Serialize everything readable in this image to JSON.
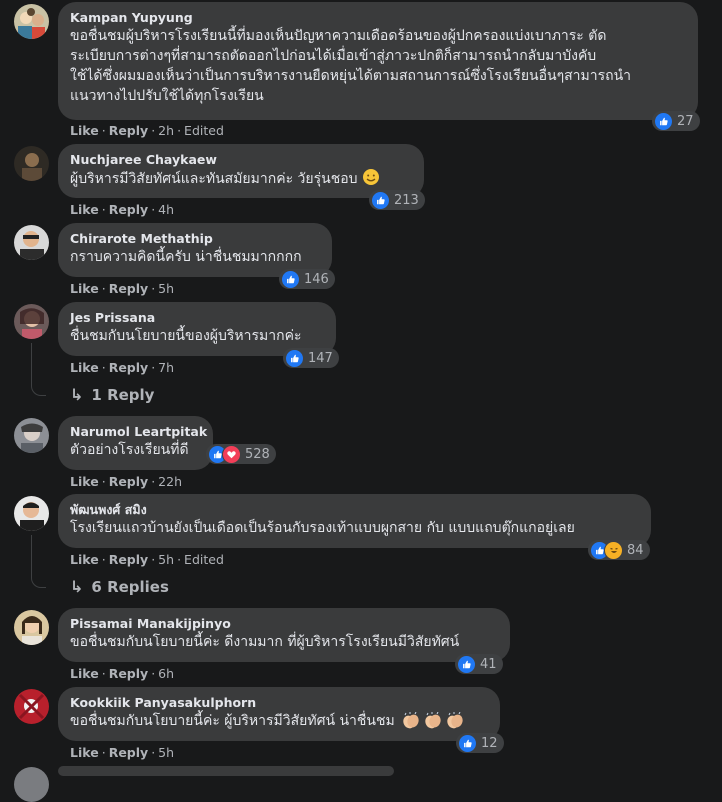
{
  "comments": [
    {
      "name": "Kampan Yupyung",
      "lines": [
        "ขอชื่นชมผู้บริหารโรงเรียนนี้ที่มองเห็นปัญหาความเดือดร้อนของผู้ปกครองแบ่งเบาภาระ ตัด",
        "ระเบียบการต่างๆที่สามารถตัดออกไปก่อนได้เมื่อเข้าสู่ภาวะปกติก็สามารถนำกลับมาบังคับ",
        "ใช้ได้ซึ่งผมมองเห็นว่าเป็นการบริหารงานยืดหยุ่นได้ตามสถานการณ์ซึ่งโรงเรียนอื่นๆสามารถนำ",
        "แนวทางไปปรับใช้ได้ทุกโรงเรียน"
      ],
      "like": "Like",
      "reply": "Reply",
      "time": "2h",
      "edited": "Edited",
      "reaction_count": "27"
    },
    {
      "name": "Nuchjaree Chaykaew",
      "text": "ผู้บริหารมีวิสัยทัศน์และทันสมัยมากค่ะ วัยรุ่นชอบ",
      "like": "Like",
      "reply": "Reply",
      "time": "4h",
      "reaction_count": "213"
    },
    {
      "name": "Chirarote Methathip",
      "text": "กราบความคิดนี้ครับ น่าชื่นชมมากกกก",
      "like": "Like",
      "reply": "Reply",
      "time": "5h",
      "reaction_count": "146"
    },
    {
      "name": "Jes Prissana",
      "text": "ชื่นชมกับนโยบายนี้ของผู้บริหารมากค่ะ",
      "like": "Like",
      "reply": "Reply",
      "time": "7h",
      "reaction_count": "147",
      "replies": "1 Reply"
    },
    {
      "name": "Narumol Leartpitak",
      "text": "ตัวอย่างโรงเรียนที่ดี",
      "like": "Like",
      "reply": "Reply",
      "time": "22h",
      "reaction_count": "528"
    },
    {
      "name": "พัฒนพงศ์ สมิง",
      "text": "โรงเรียนแถวบ้านยังเป็นเดือดเป็นร้อนกับรองเท้าแบบผูกสาย กับ แบบแถบตุ๊กแกอยู่เลย",
      "like": "Like",
      "reply": "Reply",
      "time": "5h",
      "edited": "Edited",
      "reaction_count": "84",
      "replies": "6 Replies"
    },
    {
      "name": "Pissamai Manakijpinyo",
      "text": "ขอชื่นชมกับนโยบายนี้ค่ะ ดีงามมาก ที่ผู้บริหารโรงเรียนมีวิสัยทัศน์",
      "like": "Like",
      "reply": "Reply",
      "time": "6h",
      "reaction_count": "41"
    },
    {
      "name": "Kookkiik Panyasakulphorn",
      "text": "ขอชื่นชมกับนโยบายนี้ค่ะ ผู้บริหารมีวิสัยทัศน์ น่าชื่นชม",
      "like": "Like",
      "reply": "Reply",
      "time": "5h",
      "reaction_count": "12"
    }
  ],
  "colors": {
    "background": "#18191a",
    "bubble": "#3a3b3c",
    "text": "#e4e6eb",
    "secondary_text": "#b0b3b8",
    "like_blue": "#2078f4",
    "love_red": "#f33e58",
    "haha_yellow": "#f7b125"
  },
  "icons": [
    "like-reaction-icon",
    "love-reaction-icon",
    "haha-reaction-icon",
    "reply-arrow-icon",
    "clapping-hands-emoji",
    "smiling-face-emoji"
  ]
}
